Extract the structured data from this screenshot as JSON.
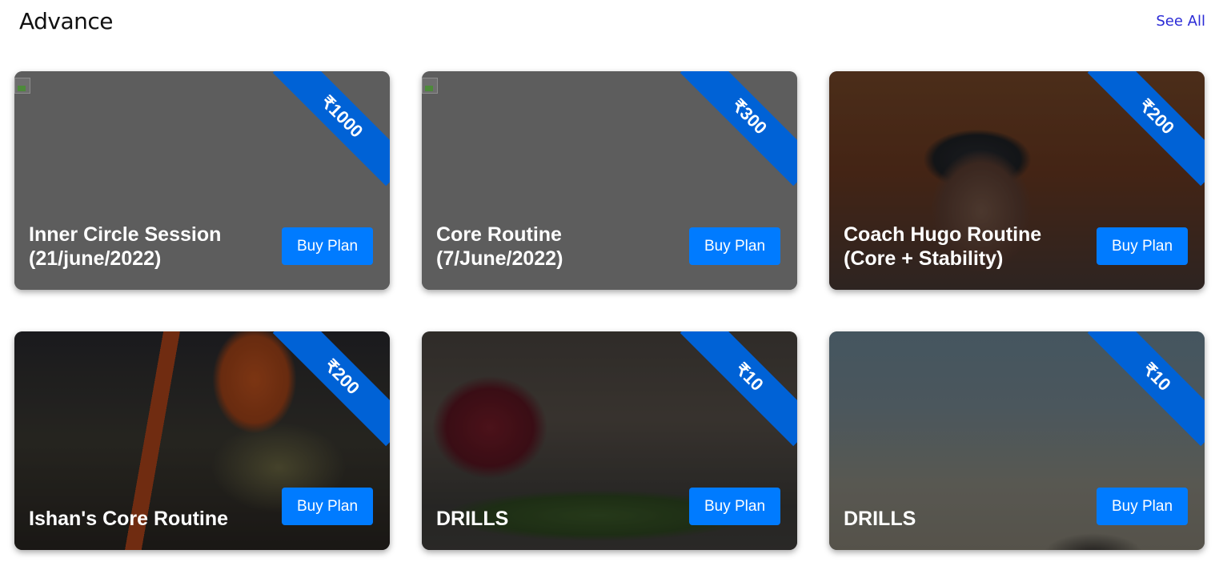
{
  "section": {
    "title": "Advance",
    "see_all_label": "See All"
  },
  "colors": {
    "ribbon": "#0062d6",
    "button": "#007bff",
    "link": "#2a2ad6"
  },
  "cards": [
    {
      "title": "Inner Circle Session\n(21/june/2022)",
      "price": "₹1000",
      "button_label": "Buy Plan",
      "image": "broken-image"
    },
    {
      "title": "Core Routine\n(7/June/2022)",
      "price": "₹300",
      "button_label": "Buy Plan",
      "image": "broken-image"
    },
    {
      "title": "Coach Hugo Routine\n(Core + Stability)",
      "price": "₹200",
      "button_label": "Buy Plan",
      "image": "coach-portrait-photo"
    },
    {
      "title": "Ishan's Core Routine",
      "price": "₹200",
      "button_label": "Buy Plan",
      "image": "event-banners-photo"
    },
    {
      "title": "DRILLS",
      "price": "₹10",
      "button_label": "Buy Plan",
      "image": "runners-drills-photo"
    },
    {
      "title": "DRILLS",
      "price": "₹10",
      "button_label": "Buy Plan",
      "image": "runner-outdoor-photo"
    }
  ]
}
